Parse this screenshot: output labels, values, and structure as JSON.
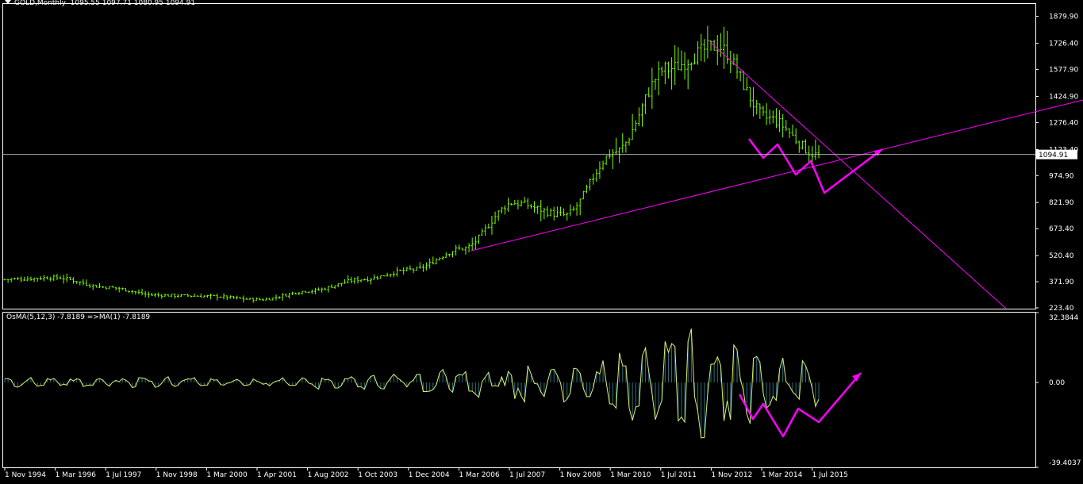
{
  "header": {
    "symbol": "GOLD,Monthly",
    "ohlc": "1095.55 1097.71 1080.95 1094.91"
  },
  "price_axis": {
    "labels": [
      "1879.90",
      "1726.40",
      "1577.90",
      "1424.90",
      "1276.40",
      "1123.40",
      "974.90",
      "821.90",
      "673.40",
      "520.40",
      "371.90",
      "223.40"
    ],
    "current_price": "1094.91"
  },
  "indicator": {
    "title": "OsMA(5,12,3) -7.8189  =>MA(1) -7.8189",
    "axis_labels": [
      "32.3844",
      "0.00",
      "-39.4037"
    ]
  },
  "time_axis": {
    "labels": [
      "1 Nov 1994",
      "1 Mar 1996",
      "1 Jul 1997",
      "1 Nov 1998",
      "1 Mar 2000",
      "1 Apr 2001",
      "1 Aug 2002",
      "1 Oct 2003",
      "1 Dec 2004",
      "1 Mar 2006",
      "1 Jul 2007",
      "1 Nov 2008",
      "1 Mar 2010",
      "1 Jul 2011",
      "1 Nov 2012",
      "1 Mar 2014",
      "1 Jul 2015"
    ]
  },
  "colors": {
    "background": "#000000",
    "bars": "#7cfc00",
    "trendlines": "#ff00ff",
    "drawing_arrows": "#ff00ff",
    "osma_hist": "#2f6f7f",
    "osma_line": "#d8f070",
    "grid_text": "#ffffff"
  },
  "chart_data": [
    {
      "type": "line",
      "title": "GOLD,Monthly",
      "categories": [
        "1 Nov 1994",
        "1 Mar 1996",
        "1 Jul 1997",
        "1 Nov 1998",
        "1 Mar 2000",
        "1 Apr 2001",
        "1 Aug 2002",
        "1 Oct 2003",
        "1 Dec 2004",
        "1 Mar 2006",
        "1 Jul 2007",
        "1 Nov 2008",
        "1 Mar 2010",
        "1 Jul 2011",
        "1 Nov 2012",
        "1 Mar 2014",
        "1 Jul 2015"
      ],
      "series": [
        {
          "values": [
            385,
            395,
            340,
            295,
            290,
            270,
            320,
            385,
            440,
            560,
            820,
            750,
            1110,
            1580,
            1710,
            1300,
            1090
          ]
        }
      ],
      "ylim": [
        223.4,
        1950
      ],
      "last_close": 1094.91,
      "grid": false
    },
    {
      "type": "bar",
      "title": "OsMA(5,12,3) -7.8189  =>MA(1) -7.8189",
      "categories": [
        "1 Nov 1994",
        "1 Mar 1996",
        "1 Jul 1997",
        "1 Nov 1998",
        "1 Mar 2000",
        "1 Apr 2001",
        "1 Aug 2002",
        "1 Oct 2003",
        "1 Dec 2004",
        "1 Mar 2006",
        "1 Jul 2007",
        "1 Nov 2008",
        "1 Mar 2010",
        "1 Jul 2011",
        "1 Nov 2012",
        "1 Mar 2014",
        "1 Jul 2015"
      ],
      "series": [
        {
          "values": [
            1,
            -1,
            0,
            2,
            -1,
            0,
            1,
            2,
            3,
            6,
            -5,
            10,
            8,
            30,
            -20,
            14,
            -7.8189
          ]
        }
      ],
      "ylim": [
        -39.4037,
        32.3844
      ]
    }
  ]
}
